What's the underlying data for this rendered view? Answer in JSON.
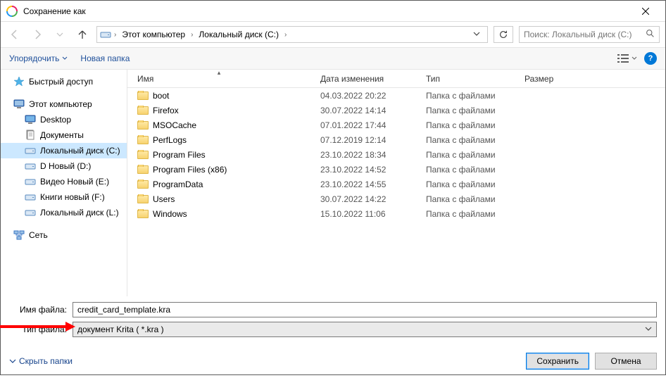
{
  "titlebar": {
    "title": "Сохранение как"
  },
  "nav": {
    "path": [
      "Этот компьютер",
      "Локальный диск (C:)"
    ],
    "search_placeholder": "Поиск: Локальный диск (C:)"
  },
  "toolbar": {
    "organize": "Упорядочить",
    "new_folder": "Новая папка",
    "help": "?"
  },
  "sidebar": {
    "quick": "Быстрый доступ",
    "this_pc": "Этот компьютер",
    "items": [
      {
        "label": "Desktop",
        "icon": "desktop"
      },
      {
        "label": "Документы",
        "icon": "documents"
      },
      {
        "label": "Локальный диск (C:)",
        "icon": "drive",
        "selected": true
      },
      {
        "label": "D Новый (D:)",
        "icon": "drive"
      },
      {
        "label": "Видео Новый (E:)",
        "icon": "drive"
      },
      {
        "label": "Книги новый (F:)",
        "icon": "drive"
      },
      {
        "label": "Локальный диск (L:)",
        "icon": "drive"
      }
    ],
    "network": "Сеть"
  },
  "columns": {
    "name": "Имя",
    "date": "Дата изменения",
    "type": "Тип",
    "size": "Размер"
  },
  "files": [
    {
      "name": "boot",
      "date": "04.03.2022 20:22",
      "type": "Папка с файлами"
    },
    {
      "name": "Firefox",
      "date": "30.07.2022 14:14",
      "type": "Папка с файлами"
    },
    {
      "name": "MSOCache",
      "date": "07.01.2022 17:44",
      "type": "Папка с файлами"
    },
    {
      "name": "PerfLogs",
      "date": "07.12.2019 12:14",
      "type": "Папка с файлами"
    },
    {
      "name": "Program Files",
      "date": "23.10.2022 18:34",
      "type": "Папка с файлами"
    },
    {
      "name": "Program Files (x86)",
      "date": "23.10.2022 14:52",
      "type": "Папка с файлами"
    },
    {
      "name": "ProgramData",
      "date": "23.10.2022 14:55",
      "type": "Папка с файлами"
    },
    {
      "name": "Users",
      "date": "30.07.2022 14:22",
      "type": "Папка с файлами"
    },
    {
      "name": "Windows",
      "date": "15.10.2022 11:06",
      "type": "Папка с файлами"
    }
  ],
  "form": {
    "filename_label": "Имя файла:",
    "filename_value": "credit_card_template.kra",
    "filetype_label": "Тип файла:",
    "filetype_value": "документ Krita ( *.kra )"
  },
  "footer": {
    "hide_folders": "Скрыть папки",
    "save": "Сохранить",
    "cancel": "Отмена"
  }
}
